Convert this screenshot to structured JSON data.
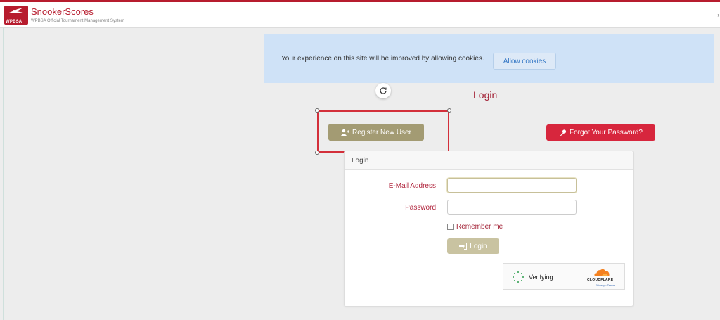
{
  "header": {
    "logo_text": "WPBSA",
    "brand_name": "SnookerScores",
    "brand_tagline": "WPBSA Official Tournament Management System",
    "accent_color": "#b71c2e"
  },
  "cookie_banner": {
    "message": "Your experience on this site will be improved by allowing cookies.",
    "button_label": "Allow cookies"
  },
  "page": {
    "title": "Login"
  },
  "actions": {
    "register_label": "Register New User",
    "register_icon": "user-plus-icon",
    "forgot_label": "Forgot Your Password?",
    "forgot_icon": "key-icon"
  },
  "login_card": {
    "header": "Login",
    "email_label": "E-Mail Address",
    "email_value": "",
    "password_label": "Password",
    "password_value": "",
    "remember_label": "Remember me",
    "submit_label": "Login",
    "submit_icon": "sign-in-icon"
  },
  "captcha": {
    "status": "Verifying...",
    "provider": "CLOUDFLARE",
    "links": "Privacy • Terms"
  }
}
